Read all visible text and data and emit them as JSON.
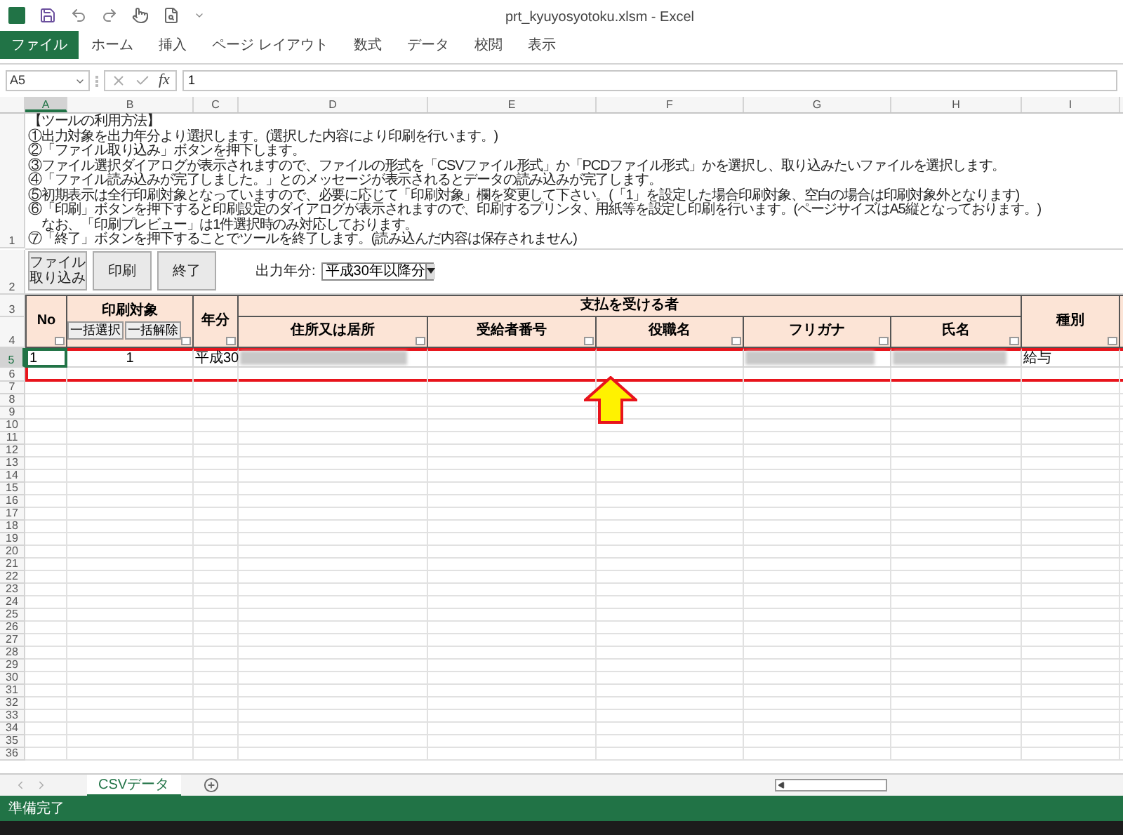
{
  "window": {
    "title": "prt_kyuyosyotoku.xlsm - Excel"
  },
  "ribbon_tabs": [
    {
      "label": "ファイル",
      "kind": "file"
    },
    {
      "label": "ホーム",
      "kind": "tab"
    },
    {
      "label": "挿入",
      "kind": "tab"
    },
    {
      "label": "ページ レイアウト",
      "kind": "tab"
    },
    {
      "label": "数式",
      "kind": "tab"
    },
    {
      "label": "データ",
      "kind": "tab"
    },
    {
      "label": "校閲",
      "kind": "tab"
    },
    {
      "label": "表示",
      "kind": "tab"
    }
  ],
  "formula_bar": {
    "name_box": "A5",
    "function_label": "fx",
    "value": "1"
  },
  "columns": [
    {
      "label": "A",
      "selected": true
    },
    {
      "label": "B",
      "selected": false
    },
    {
      "label": "C",
      "selected": false
    },
    {
      "label": "D",
      "selected": false
    },
    {
      "label": "E",
      "selected": false
    },
    {
      "label": "F",
      "selected": false
    },
    {
      "label": "G",
      "selected": false
    },
    {
      "label": "H",
      "selected": false
    },
    {
      "label": "I",
      "selected": false
    }
  ],
  "rows": [
    {
      "label": "1",
      "selected": false
    },
    {
      "label": "2",
      "selected": false
    },
    {
      "label": "3",
      "selected": false
    },
    {
      "label": "4",
      "selected": false
    },
    {
      "label": "5",
      "selected": true
    },
    {
      "label": "6",
      "selected": false
    },
    {
      "label": "7",
      "selected": false
    },
    {
      "label": "8",
      "selected": false
    },
    {
      "label": "9",
      "selected": false
    },
    {
      "label": "10",
      "selected": false
    },
    {
      "label": "11",
      "selected": false
    },
    {
      "label": "12",
      "selected": false
    },
    {
      "label": "13",
      "selected": false
    },
    {
      "label": "14",
      "selected": false
    },
    {
      "label": "15",
      "selected": false
    },
    {
      "label": "16",
      "selected": false
    },
    {
      "label": "17",
      "selected": false
    },
    {
      "label": "18",
      "selected": false
    },
    {
      "label": "19",
      "selected": false
    },
    {
      "label": "20",
      "selected": false
    },
    {
      "label": "21",
      "selected": false
    },
    {
      "label": "22",
      "selected": false
    },
    {
      "label": "23",
      "selected": false
    },
    {
      "label": "24",
      "selected": false
    },
    {
      "label": "25",
      "selected": false
    },
    {
      "label": "26",
      "selected": false
    },
    {
      "label": "27",
      "selected": false
    },
    {
      "label": "28",
      "selected": false
    },
    {
      "label": "29",
      "selected": false
    },
    {
      "label": "30",
      "selected": false
    },
    {
      "label": "31",
      "selected": false
    },
    {
      "label": "32",
      "selected": false
    },
    {
      "label": "33",
      "selected": false
    },
    {
      "label": "34",
      "selected": false
    },
    {
      "label": "35",
      "selected": false
    },
    {
      "label": "36",
      "selected": false
    }
  ],
  "instructions": [
    "【ツールの利用方法】",
    "①出力対象を出力年分より選択します。(選択した内容により印刷を行います。)",
    "②「ファイル取り込み」ボタンを押下します。",
    "③ファイル選択ダイアログが表示されますので、ファイルの形式を「CSVファイル形式」か「PCDファイル形式」かを選択し、取り込みたいファイルを選択します。",
    "④「ファイル読み込みが完了しました。」とのメッセージが表示されるとデータの読み込みが完了します。",
    "⑤初期表示は全行印刷対象となっていますので、必要に応じて「印刷対象」欄を変更して下さい。(「1」を設定した場合印刷対象、空白の場合は印刷対象外となります)",
    "⑥「印刷」ボタンを押下すると印刷設定のダイアログが表示されますので、印刷するプリンタ、用紙等を設定し印刷を行います。(ページサイズはA5縦となっております。)",
    "　なお、「印刷プレビュー」は1件選択時のみ対応しております。",
    "⑦「終了」ボタンを押下することでツールを終了します。(読み込んだ内容は保存されません)"
  ],
  "buttons": [
    "ファイル取り込み",
    "印刷",
    "終了"
  ],
  "year_select": {
    "label": "出力年分:",
    "value": "平成30年以降分"
  },
  "table": {
    "no": "No",
    "print_target": "印刷対象",
    "select_all": "一括選択",
    "clear_all": "一括解除",
    "year": "年分",
    "payee_group": "支払を受ける者",
    "payee_columns": [
      "住所又は居所",
      "受給者番号",
      "役職名",
      "フリガナ",
      "氏名"
    ],
    "type": "種別",
    "row": [
      {
        "kind": "text",
        "text": "1"
      },
      {
        "kind": "text",
        "text": "1"
      },
      {
        "kind": "text",
        "text": "平成30"
      },
      {
        "kind": "redacted"
      },
      {
        "kind": "empty"
      },
      {
        "kind": "empty"
      },
      {
        "kind": "redacted"
      },
      {
        "kind": "redacted"
      },
      {
        "kind": "text",
        "text": "給与"
      }
    ]
  },
  "sheet_tabs": [
    {
      "label": "CSVデータ",
      "selected": true
    }
  ],
  "status_bar": {
    "text": "準備完了"
  }
}
